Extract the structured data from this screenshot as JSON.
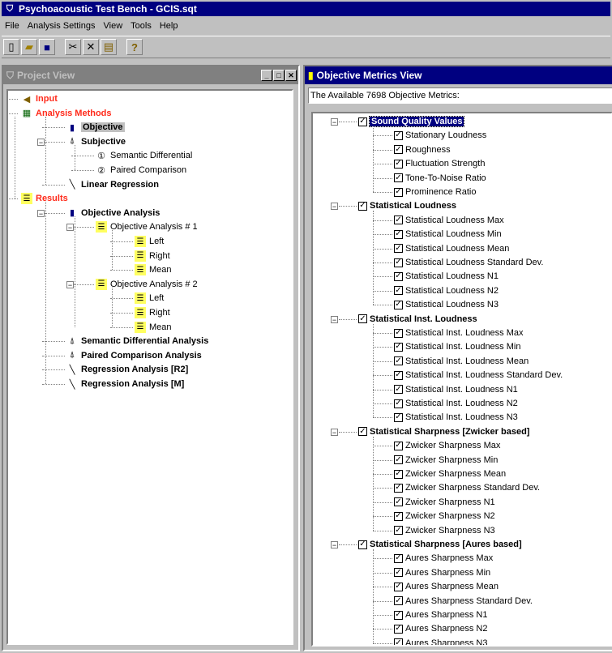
{
  "window": {
    "title": "Psychoacoustic Test Bench - GCIS.sqt"
  },
  "menu": [
    "File",
    "Analysis Settings",
    "View",
    "Tools",
    "Help"
  ],
  "toolbar": [
    {
      "icon": "new-file-icon",
      "glyph": "🗋"
    },
    {
      "icon": "open-folder-icon",
      "glyph": "📂"
    },
    {
      "icon": "save-icon",
      "glyph": "💾"
    },
    {
      "icon": "cut-icon",
      "glyph": "✂"
    },
    {
      "icon": "delete-icon",
      "glyph": "✕"
    },
    {
      "icon": "paste-icon",
      "glyph": "📋"
    },
    {
      "icon": "help-icon",
      "glyph": "?"
    }
  ],
  "project_view": {
    "title": "Project View",
    "tree": [
      {
        "label": "Input",
        "level": 0,
        "style": "red",
        "icon": "input-icon"
      },
      {
        "label": "Analysis Methods",
        "level": 0,
        "style": "red",
        "icon": "analysis-icon",
        "expand": "minus"
      },
      {
        "label": "Objective",
        "level": 1,
        "style": "bold selected",
        "icon": "objective-icon"
      },
      {
        "label": "Subjective",
        "level": 1,
        "style": "bold",
        "icon": "subjective-icon",
        "expand": "minus"
      },
      {
        "label": "Semantic Differential",
        "level": 2,
        "style": "",
        "icon": "number-1-icon",
        "glyph": "①"
      },
      {
        "label": "Paired Comparison",
        "level": 2,
        "style": "",
        "icon": "number-2-icon",
        "glyph": "②"
      },
      {
        "label": "Linear Regression",
        "level": 1,
        "style": "bold",
        "icon": "regression-icon"
      },
      {
        "label": "Results",
        "level": 0,
        "style": "red",
        "icon": "results-icon",
        "expand": "minus"
      },
      {
        "label": "Objective Analysis",
        "level": 1,
        "style": "bold",
        "icon": "objective-icon",
        "expand": "minus"
      },
      {
        "label": "Objective Analysis # 1",
        "level": 2,
        "style": "",
        "icon": "results-icon",
        "expand": "minus"
      },
      {
        "label": "Left",
        "level": 3,
        "style": "",
        "icon": "results-icon"
      },
      {
        "label": "Right",
        "level": 3,
        "style": "",
        "icon": "results-icon"
      },
      {
        "label": "Mean",
        "level": 3,
        "style": "",
        "icon": "results-icon"
      },
      {
        "label": "Objective Analysis # 2",
        "level": 2,
        "style": "",
        "icon": "results-icon",
        "expand": "minus"
      },
      {
        "label": "Left",
        "level": 3,
        "style": "",
        "icon": "results-icon"
      },
      {
        "label": "Right",
        "level": 3,
        "style": "",
        "icon": "results-icon"
      },
      {
        "label": "Mean",
        "level": 3,
        "style": "",
        "icon": "results-icon"
      },
      {
        "label": "Semantic Differential Analysis",
        "level": 1,
        "style": "bold",
        "icon": "subjective-icon"
      },
      {
        "label": "Paired Comparison Analysis",
        "level": 1,
        "style": "bold",
        "icon": "subjective-icon"
      },
      {
        "label": "Regression Analysis [R2]",
        "level": 1,
        "style": "bold",
        "icon": "regression-icon"
      },
      {
        "label": "Regression Analysis [M]",
        "level": 1,
        "style": "bold",
        "icon": "regression-icon"
      }
    ]
  },
  "metrics_view": {
    "title": "Objective Metrics View",
    "status": "The Available 7698 Objective Metrics:",
    "groups": [
      {
        "label": "Sound Quality Values",
        "selected": true,
        "items": [
          "Stationary Loudness",
          "Roughness",
          "Fluctuation Strength",
          "Tone-To-Noise Ratio",
          "Prominence Ratio"
        ]
      },
      {
        "label": "Statistical Loudness",
        "items": [
          "Statistical Loudness Max",
          "Statistical Loudness Min",
          "Statistical Loudness Mean",
          "Statistical Loudness Standard Dev.",
          "Statistical Loudness N1",
          "Statistical Loudness N2",
          "Statistical Loudness N3"
        ]
      },
      {
        "label": "Statistical Inst. Loudness",
        "items": [
          "Statistical Inst. Loudness Max",
          "Statistical Inst. Loudness Min",
          "Statistical Inst. Loudness Mean",
          "Statistical Inst. Loudness Standard Dev.",
          "Statistical Inst. Loudness N1",
          "Statistical Inst. Loudness N2",
          "Statistical Inst. Loudness N3"
        ]
      },
      {
        "label": "Statistical Sharpness [Zwicker based]",
        "items": [
          "Zwicker Sharpness Max",
          "Zwicker Sharpness Min",
          "Zwicker Sharpness Mean",
          "Zwicker Sharpness Standard Dev.",
          "Zwicker Sharpness N1",
          "Zwicker Sharpness N2",
          "Zwicker Sharpness N3"
        ]
      },
      {
        "label": "Statistical Sharpness [Aures based]",
        "items": [
          "Aures Sharpness Max",
          "Aures Sharpness Min",
          "Aures Sharpness Mean",
          "Aures Sharpness Standard Dev.",
          "Aures Sharpness N1",
          "Aures Sharpness N2",
          "Aures Sharpness N3"
        ]
      }
    ]
  }
}
